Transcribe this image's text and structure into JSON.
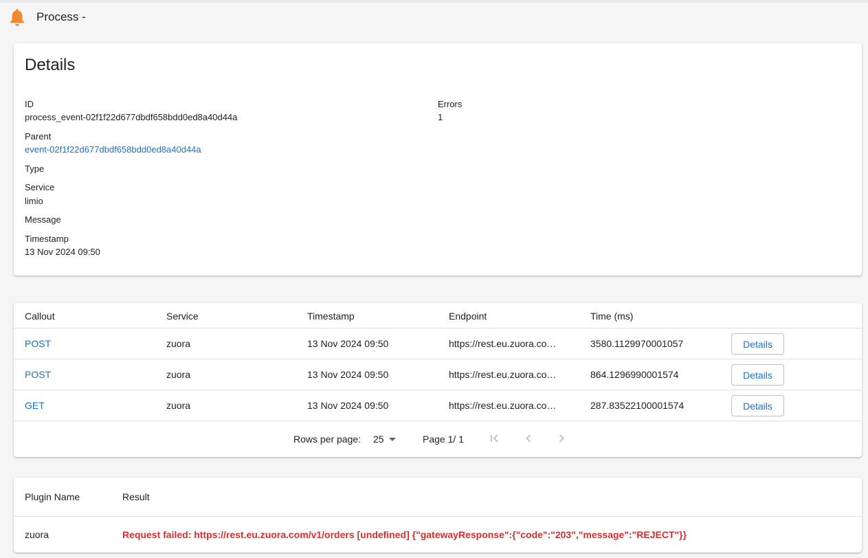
{
  "header": {
    "title": "Process -",
    "icon": "bell-icon",
    "icon_color": "#f08a2c"
  },
  "details": {
    "title": "Details",
    "id_label": "ID",
    "id_value": "process_event-02f1f22d677dbdf658bdd0ed8a40d44a",
    "parent_label": "Parent",
    "parent_value": "event-02f1f22d677dbdf658bdd0ed8a40d44a",
    "type_label": "Type",
    "service_label": "Service",
    "service_value": "limio",
    "message_label": "Message",
    "timestamp_label": "Timestamp",
    "timestamp_value": "13 Nov 2024 09:50",
    "errors_label": "Errors",
    "errors_value": "1"
  },
  "callouts": {
    "headers": [
      "Callout",
      "Service",
      "Timestamp",
      "Endpoint",
      "Time (ms)"
    ],
    "rows": [
      {
        "method": "POST",
        "service": "zuora",
        "timestamp": "13 Nov 2024 09:50",
        "endpoint": "https://rest.eu.zuora.co…",
        "time": "3580.1129970001057",
        "action": "Details"
      },
      {
        "method": "POST",
        "service": "zuora",
        "timestamp": "13 Nov 2024 09:50",
        "endpoint": "https://rest.eu.zuora.co…",
        "time": "864.1296990001574",
        "action": "Details"
      },
      {
        "method": "GET",
        "service": "zuora",
        "timestamp": "13 Nov 2024 09:50",
        "endpoint": "https://rest.eu.zuora.co…",
        "time": "287.83522100001574",
        "action": "Details"
      }
    ],
    "pagination": {
      "rows_per_page_label": "Rows per page:",
      "rows_per_page_value": "25",
      "page_label": "Page 1/ 1"
    }
  },
  "plugins": {
    "headers": [
      "Plugin Name",
      "Result"
    ],
    "rows": [
      {
        "name": "zuora",
        "result": "Request failed: https://rest.eu.zuora.com/v1/orders [undefined] {\"gatewayResponse\":{\"code\":\"203\",\"message\":\"REJECT\"}}"
      }
    ],
    "error_color": "#d32f2f"
  }
}
